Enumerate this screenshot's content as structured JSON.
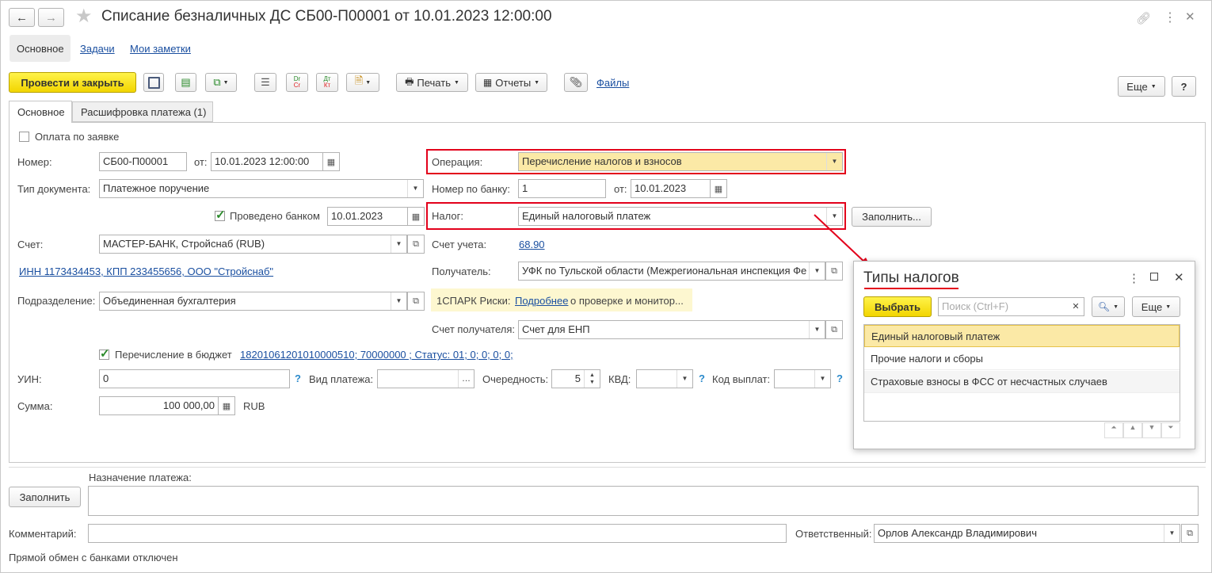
{
  "window": {
    "title": "Списание безналичных ДС СБ00-П00001 от 10.01.2023 12:00:00"
  },
  "nav_tabs": [
    "Основное",
    "Задачи",
    "Мои заметки"
  ],
  "toolbar": {
    "post_close": "Провести и закрыть",
    "print": "Печать",
    "reports": "Отчеты",
    "files": "Файлы",
    "more": "Еще",
    "help": "?"
  },
  "form_tabs": [
    "Основное",
    "Расшифровка платежа (1)"
  ],
  "form": {
    "pay_by_request": "Оплата по заявке",
    "number_label": "Номер:",
    "number_value": "СБ00-П00001",
    "from_label": "от:",
    "date_value": "10.01.2023 12:00:00",
    "doc_type_label": "Тип документа:",
    "doc_type_value": "Платежное поручение",
    "bank_posted_label": "Проведено банком",
    "bank_posted_date": "10.01.2023",
    "account_label": "Счет:",
    "account_value": "МАСТЕР-БАНК, Стройснаб (RUB)",
    "inn_link": "ИНН 1173434453, КПП 233455656, ООО \"Стройснаб\"",
    "division_label": "Подразделение:",
    "division_value": "Объединенная бухгалтерия",
    "operation_label": "Операция:",
    "operation_value": "Перечисление налогов и взносов",
    "bank_number_label": "Номер по банку:",
    "bank_number_value": "1",
    "bank_from_label": "от:",
    "bank_date_value": "10.01.2023",
    "tax_label": "Налог:",
    "tax_value": "Единый налоговый платеж",
    "fill_button": "Заполнить...",
    "account_acc_label": "Счет учета:",
    "account_acc_value": "68.90",
    "recipient_label": "Получатель:",
    "recipient_value": "УФК по Тульской области (Межрегиональная инспекция Фе",
    "spark_prefix": "1СПАРК Риски:",
    "spark_link": "Подробнее",
    "spark_suffix": "о проверке и монитор...",
    "recipient_account_label": "Счет получателя:",
    "recipient_account_value": "Счет для ЕНП",
    "budget_label": "Перечисление в бюджет",
    "budget_link": "18201061201010000510; 70000000   ; Статус: 01; 0; 0; 0; 0;",
    "uin_label": "УИН:",
    "uin_value": "0",
    "payment_kind_label": "Вид платежа:",
    "payment_kind_value": "",
    "priority_label": "Очередность:",
    "priority_value": "5",
    "kvd_label": "КВД:",
    "payout_code_label": "Код выплат:",
    "amount_label": "Сумма:",
    "amount_value": "100 000,00",
    "currency": "RUB"
  },
  "bottom": {
    "fill_button": "Заполнить",
    "purpose_label": "Назначение платежа:",
    "comment_label": "Комментарий:",
    "responsible_label": "Ответственный:",
    "responsible_value": "Орлов Александр Владимирович",
    "status_text": "Прямой обмен с банками отключен"
  },
  "popup": {
    "title": "Типы налогов",
    "select_button": "Выбрать",
    "search_placeholder": "Поиск (Ctrl+F)",
    "more_button": "Еще",
    "items": [
      "Единый налоговый платеж",
      "Прочие налоги и сборы",
      "Страховые взносы в ФСС от несчастных случаев"
    ]
  },
  "colors": {
    "accent_yellow": "#f2d500",
    "highlight": "#fbe9a6",
    "annotation_red": "#e3001b",
    "link": "#1a4fa0"
  }
}
